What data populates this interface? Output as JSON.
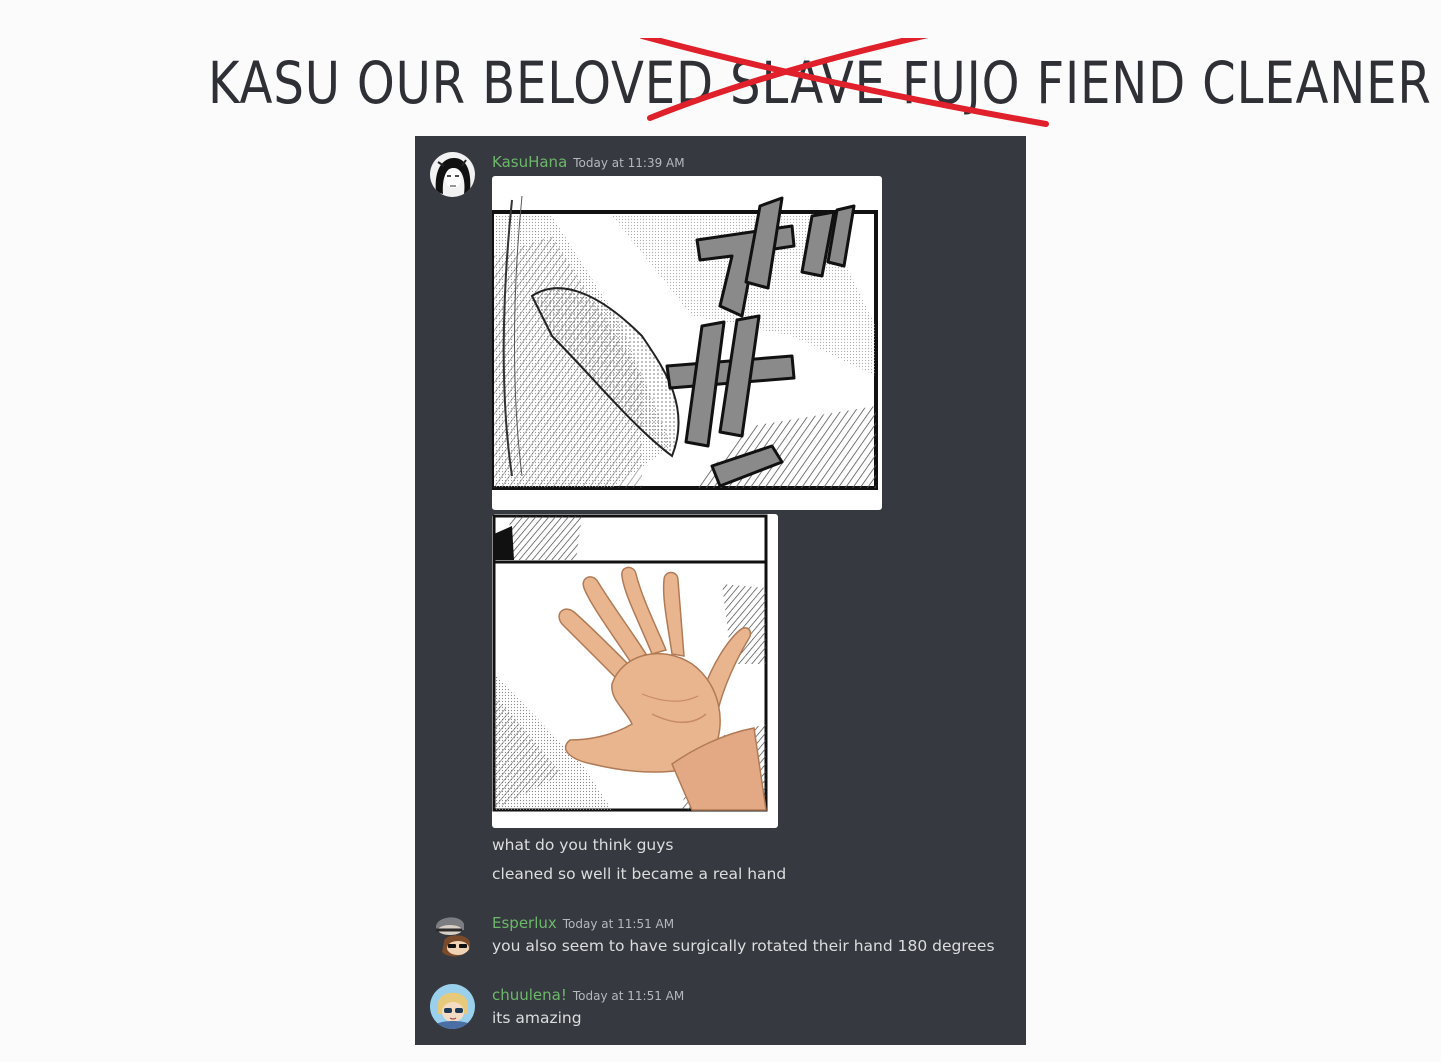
{
  "headline": {
    "prefix": "KASU OUR BELOVED ",
    "struck": "SLAVE FUJO FIEND",
    "suffix": " CLEANER",
    "strike_color": "#e0202a"
  },
  "messages": [
    {
      "username": "KasuHana",
      "timestamp": "Today at 11:39 AM",
      "lines": [
        "what do you think guys",
        "cleaned so well it became a real hand"
      ],
      "attachments": [
        "manga-panel-image",
        "edited-hand-panel-image"
      ]
    },
    {
      "username": "Esperlux",
      "timestamp": "Today at 11:51 AM",
      "lines": [
        "you also seem to have surgically rotated their hand 180 degrees"
      ]
    },
    {
      "username": "chuulena!",
      "timestamp": "Today at 11:51 AM",
      "lines": [
        "its amazing"
      ]
    }
  ],
  "colors": {
    "chat_bg": "#36393f",
    "username": "#6cb86a",
    "text": "#dcddde",
    "timestamp": "#b6b8bd"
  }
}
